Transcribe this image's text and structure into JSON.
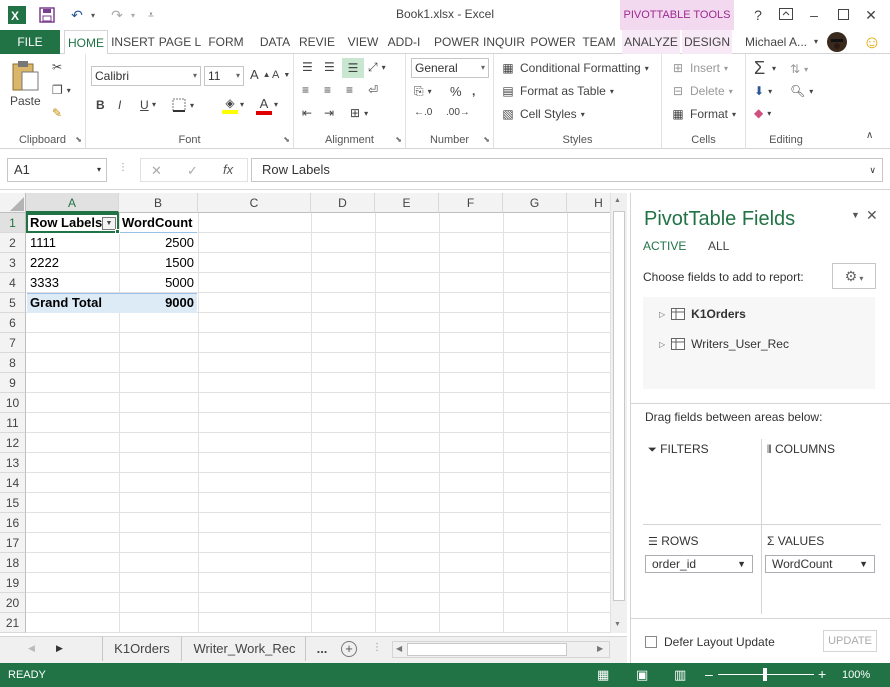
{
  "window": {
    "title": "Book1.xlsx - Excel",
    "context_tab_group": "PIVOTTABLE TOOLS",
    "help": "?",
    "user": "Michael A...",
    "smiley": "☺"
  },
  "tabs": [
    {
      "label": "FILE"
    },
    {
      "label": "HOME"
    },
    {
      "label": "INSERT"
    },
    {
      "label": "PAGE L"
    },
    {
      "label": "FORM"
    },
    {
      "label": "DATA"
    },
    {
      "label": "REVIE"
    },
    {
      "label": "VIEW"
    },
    {
      "label": "ADD-I"
    },
    {
      "label": "POWER"
    },
    {
      "label": "INQUIR"
    },
    {
      "label": "POWER"
    },
    {
      "label": "TEAM"
    },
    {
      "label": "ANALYZE"
    },
    {
      "label": "DESIGN"
    }
  ],
  "ribbon": {
    "clipboard": {
      "label": "Clipboard",
      "paste": "Paste"
    },
    "font": {
      "label": "Font",
      "name": "Calibri",
      "size": "11",
      "bold": "B",
      "italic": "I",
      "underline": "U",
      "grow": "A",
      "shrink": "A"
    },
    "alignment": {
      "label": "Alignment"
    },
    "number": {
      "label": "Number",
      "format": "General",
      "percent": "%"
    },
    "styles": {
      "label": "Styles",
      "conditional": "Conditional Formatting",
      "format_table": "Format as Table",
      "cell_styles": "Cell Styles"
    },
    "cells": {
      "label": "Cells",
      "insert": "Insert",
      "delete": "Delete",
      "format": "Format"
    },
    "editing": {
      "label": "Editing",
      "sum": "Σ"
    }
  },
  "formula_bar": {
    "name_box": "A1",
    "fx": "fx",
    "content": "Row Labels"
  },
  "grid": {
    "columns": [
      "A",
      "B",
      "C",
      "D",
      "E",
      "F",
      "G",
      "H"
    ],
    "rows": [
      "1",
      "2",
      "3",
      "4",
      "5",
      "6",
      "7",
      "8",
      "9",
      "10",
      "11",
      "12",
      "13",
      "14",
      "15",
      "16",
      "17",
      "18",
      "19",
      "20",
      "21"
    ],
    "header": {
      "row_labels": "Row Labels",
      "value_header": "WordCount"
    },
    "data": [
      {
        "label": "1111",
        "value": "2500"
      },
      {
        "label": "2222",
        "value": "1500"
      },
      {
        "label": "3333",
        "value": "5000"
      }
    ],
    "total": {
      "label": "Grand Total",
      "value": "9000"
    }
  },
  "sheet_tabs": [
    {
      "label": "K1Orders"
    },
    {
      "label": "Writer_Work_Rec"
    }
  ],
  "sheet_more": "...",
  "status": {
    "ready": "READY",
    "zoom": "100%"
  },
  "pivot_pane": {
    "title": "PivotTable Fields",
    "tab_active": "ACTIVE",
    "tab_all": "ALL",
    "choose_label": "Choose fields to add to report:",
    "fields": [
      {
        "name": "K1Orders",
        "bold": true
      },
      {
        "name": "Writers_User_Rec",
        "bold": false
      }
    ],
    "drag_label": "Drag fields between areas below:",
    "filters_label": "FILTERS",
    "columns_label": "COLUMNS",
    "rows_label": "ROWS",
    "values_label": "VALUES",
    "rows_field": "order_id",
    "values_field": "WordCount",
    "defer_label": "Defer Layout Update",
    "update_label": "UPDATE"
  },
  "colors": {
    "excel_green": "#217346",
    "context_pink": "#f3d9f0",
    "context_text": "#9c2a8f",
    "pivot_header_fill": "#ddebf7"
  }
}
